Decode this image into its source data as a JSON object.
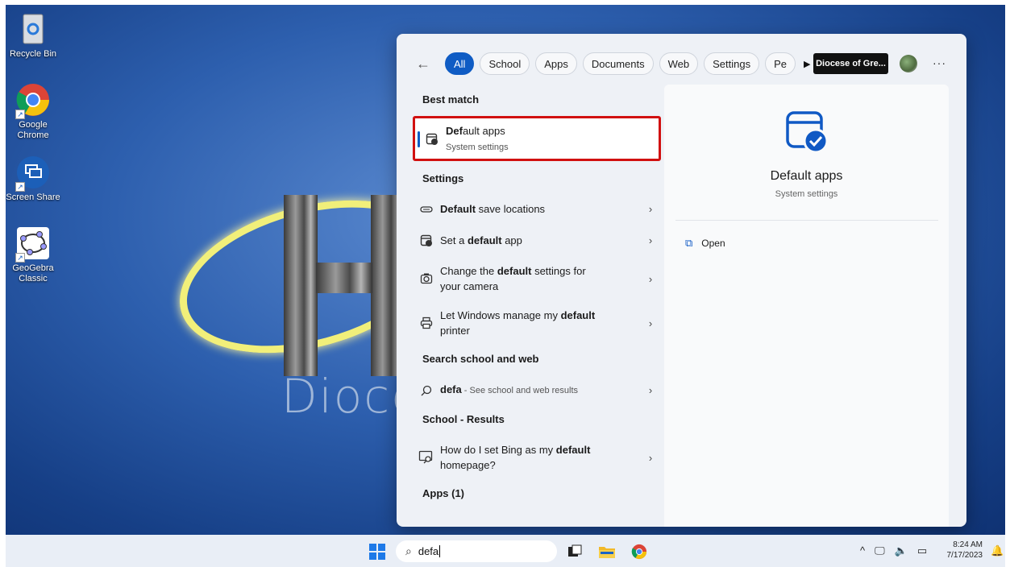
{
  "desktop": {
    "icons": [
      {
        "label": "Recycle Bin",
        "icon": "recycle-bin-icon"
      },
      {
        "label": "Google\nChrome",
        "label_line1": "Google",
        "label_line2": "Chrome",
        "icon": "chrome-icon"
      },
      {
        "label": "Screen Share",
        "icon": "screen-share-icon"
      },
      {
        "label_line1": "GeoGebra",
        "label_line2": "Classic",
        "icon": "geogebra-icon"
      }
    ],
    "wallpaper_text": "Dioce"
  },
  "search_panel": {
    "tabs": [
      "All",
      "School",
      "Apps",
      "Documents",
      "Web",
      "Settings",
      "Pe"
    ],
    "org_label": "Diocese of Gre...",
    "more_label": "···",
    "sections": {
      "best_match": "Best match",
      "settings": "Settings",
      "search_web": "Search school and web",
      "school_results": "School - Results",
      "apps": "Apps (1)"
    },
    "best": {
      "title_bold": "Def",
      "title_rest": "ault apps",
      "subtitle": "System settings"
    },
    "settings_items": [
      {
        "pre": "",
        "bold": "Default",
        "post": " save locations",
        "icon": "drive-icon"
      },
      {
        "pre": "Set a ",
        "bold": "default",
        "post": " app",
        "icon": "default-app-icon"
      },
      {
        "pre": "Change the ",
        "bold": "default",
        "post": " settings for",
        "line2": "your camera",
        "icon": "camera-icon"
      },
      {
        "pre": "Let Windows manage my ",
        "bold": "default",
        "post": "",
        "line2": "printer",
        "icon": "printer-icon"
      }
    ],
    "web_item": {
      "query": "defa",
      "suffix": " - See school and web results"
    },
    "school_item": {
      "pre": "How do I set Bing as my ",
      "bold": "default",
      "line2": "homepage?"
    },
    "preview": {
      "title": "Default apps",
      "subtitle": "System settings",
      "open_label": "Open"
    }
  },
  "taskbar": {
    "search_value": "defa",
    "time": "8:24 AM",
    "date": "7/17/2023"
  },
  "colors": {
    "accent": "#0f5cc4",
    "highlight_box": "#d11010"
  }
}
